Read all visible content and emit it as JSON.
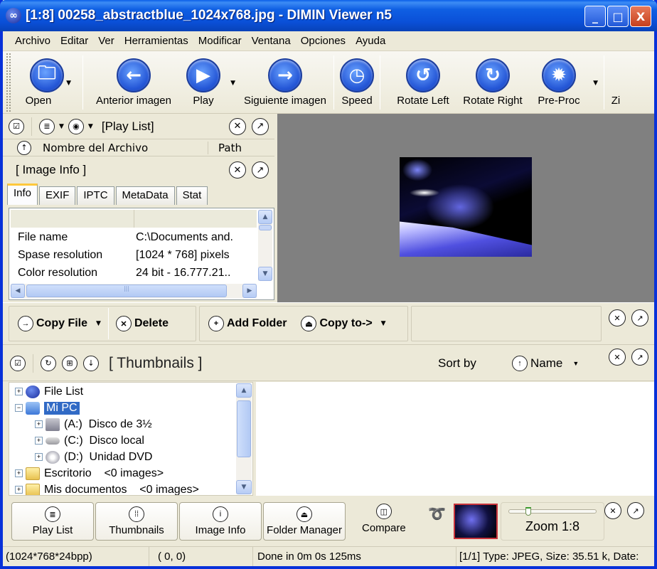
{
  "window": {
    "title": "[1:8] 00258_abstractblue_1024x768.jpg - DIMIN Viewer n5",
    "logo_icon": "dimin-logo-icon",
    "controls": {
      "minimize": "_",
      "maximize": "□",
      "close": "X"
    }
  },
  "menu": [
    "Archivo",
    "Editar",
    "Ver",
    "Herramientas",
    "Modificar",
    "Ventana",
    "Opciones",
    "Ayuda"
  ],
  "toolbar": {
    "buttons": [
      {
        "label": "Open",
        "icon": "open-folder-icon",
        "glyph": "🗀",
        "dropdown": true
      },
      {
        "label": "Anterior imagen",
        "icon": "arrow-left-icon",
        "glyph": "←",
        "dropdown": false
      },
      {
        "label": "Play",
        "icon": "play-icon",
        "glyph": "▶",
        "dropdown": true
      },
      {
        "label": "Siguiente imagen",
        "icon": "arrow-right-icon",
        "glyph": "→",
        "dropdown": false
      },
      {
        "label": "Speed",
        "icon": "clock-icon",
        "glyph": "◷",
        "dropdown": false
      },
      {
        "label": "Rotate Left",
        "icon": "rotate-left-icon",
        "glyph": "↺",
        "dropdown": false
      },
      {
        "label": "Rotate Right",
        "icon": "rotate-right-icon",
        "glyph": "↻",
        "dropdown": false
      },
      {
        "label": "Pre-Proc",
        "icon": "gear-icon",
        "glyph": "✹",
        "dropdown": true
      },
      {
        "label": "Zi",
        "icon": "",
        "glyph": "",
        "dropdown": false
      }
    ]
  },
  "playlist_panel": {
    "title": "[Play List]",
    "columns": [
      "Nombre del Archivo",
      "Path"
    ]
  },
  "image_info_panel": {
    "title": "[ Image Info ]",
    "tabs": [
      "Info",
      "EXIF",
      "IPTC",
      "MetaData",
      "Stat"
    ],
    "active_tab": "Info",
    "rows": [
      {
        "key": "File name",
        "value": "C:\\Documents and."
      },
      {
        "key": "Spase resolution",
        "value": "[1024 * 768] pixels"
      },
      {
        "key": "Color resolution",
        "value": "24 bit - 16.777.21.."
      }
    ]
  },
  "actions": {
    "copy_file": "Copy File",
    "delete": "Delete",
    "add_folder": "Add Folder",
    "copy_to": "Copy to->"
  },
  "thumbnails_panel": {
    "title": "[ Thumbnails ]",
    "sort_label": "Sort by",
    "sort_value": "Name"
  },
  "tree": [
    {
      "label": "File List",
      "level": 0,
      "expander": "+",
      "icon": "dimin-logo-icon",
      "selected": false
    },
    {
      "label": "Mi PC",
      "level": 0,
      "expander": "−",
      "icon": "computer-icon",
      "selected": true
    },
    {
      "label": "(A:)  Disco de 3½",
      "level": 1,
      "expander": "+",
      "icon": "floppy-drive-icon",
      "selected": false
    },
    {
      "label": "(C:)  Disco local",
      "level": 1,
      "expander": "+",
      "icon": "hard-drive-icon",
      "selected": false
    },
    {
      "label": "(D:)  Unidad DVD",
      "level": 1,
      "expander": "+",
      "icon": "dvd-drive-icon",
      "selected": false
    },
    {
      "label": "Escritorio    <0 images>",
      "level": 0,
      "expander": "+",
      "icon": "folder-icon",
      "selected": false
    },
    {
      "label": "Mis documentos    <0 images>",
      "level": 0,
      "expander": "+",
      "icon": "folder-icon",
      "selected": false
    }
  ],
  "bottom": {
    "buttons": [
      {
        "label": "Play List",
        "icon": "playlist-icon",
        "glyph": "≣"
      },
      {
        "label": "Thumbnails",
        "icon": "grid-icon",
        "glyph": "⁞⁞"
      },
      {
        "label": "Image Info",
        "icon": "info-icon",
        "glyph": "i"
      },
      {
        "label": "Folder Manager",
        "icon": "folder-icon",
        "glyph": "⏏"
      }
    ],
    "compare": "Compare",
    "zoom_label": "Zoom 1:8",
    "zoom_slider_fraction": 0.2
  },
  "status": {
    "dimensions": "(1024*768*24bpp)",
    "coords": "( 0,  0)",
    "timing": "Done in 0m 0s 125ms",
    "fileinfo": "[1/1] Type: JPEG, Size: 35.51 k, Date:"
  },
  "colors": {
    "titlebar": "#0a50d8",
    "selection": "#316ac5",
    "viewer_bg": "#808080",
    "face": "#ece9d8"
  }
}
